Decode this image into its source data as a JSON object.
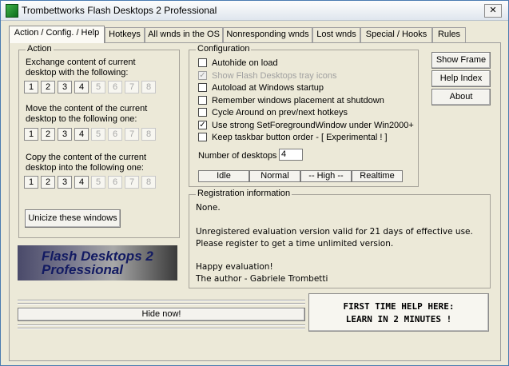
{
  "window": {
    "title": "Trombettworks Flash Desktops 2 Professional",
    "close_glyph": "✕"
  },
  "tabs": [
    {
      "label": "Action / Config. / Help",
      "active": true
    },
    {
      "label": "Hotkeys"
    },
    {
      "label": "All wnds in the OS"
    },
    {
      "label": "Nonresponding wnds"
    },
    {
      "label": "Lost wnds"
    },
    {
      "label": "Special / Hooks"
    },
    {
      "label": "Rules"
    }
  ],
  "action": {
    "title": "Action",
    "exchange_label_1": "Exchange content of current",
    "exchange_label_2": "desktop with the following:",
    "move_label_1": "Move the content of the current",
    "move_label_2": "desktop to the following one:",
    "copy_label_1": "Copy the content of the current",
    "copy_label_2": "desktop into the following one:",
    "desktop_numbers": [
      "1",
      "2",
      "3",
      "4",
      "5",
      "6",
      "7",
      "8"
    ],
    "enabled_count": 4,
    "unicize_button": "Unicize these windows"
  },
  "logo": {
    "line1": "Flash Desktops 2",
    "line2": "Professional"
  },
  "configuration": {
    "title": "Configuration",
    "options": [
      {
        "label": "Autohide on load",
        "checked": false,
        "disabled": false
      },
      {
        "label": "Show Flash Desktops tray icons",
        "checked": true,
        "disabled": true
      },
      {
        "label": "Autoload at Windows startup",
        "checked": false,
        "disabled": false
      },
      {
        "label": "Remember windows placement at shutdown",
        "checked": false,
        "disabled": false
      },
      {
        "label": "Cycle Around on prev/next hotkeys",
        "checked": false,
        "disabled": false
      },
      {
        "label": "Use strong SetForegroundWindow under Win2000+",
        "checked": true,
        "disabled": false
      },
      {
        "label": "Keep taskbar button order - [ Experimental ! ]",
        "checked": false,
        "disabled": false
      }
    ],
    "num_desktops_label": "Number of desktops",
    "num_desktops_value": "4",
    "priority": [
      "Idle",
      "Normal",
      "-- High --",
      "Realtime"
    ]
  },
  "buttons": {
    "show_frame": "Show Frame",
    "help_index": "Help Index",
    "about": "About",
    "hide_now": "Hide now!"
  },
  "registration": {
    "title": "Registration information",
    "lines": [
      "None.",
      "",
      "Unregistered evaluation version valid for 21 days of effective use.",
      "Please register to get a time unlimited version.",
      "",
      "Happy evaluation!",
      "The author - Gabriele Trombetti"
    ]
  },
  "help_banner": {
    "line1": "FIRST TIME HELP HERE:",
    "line2": "LEARN IN 2 MINUTES !"
  }
}
